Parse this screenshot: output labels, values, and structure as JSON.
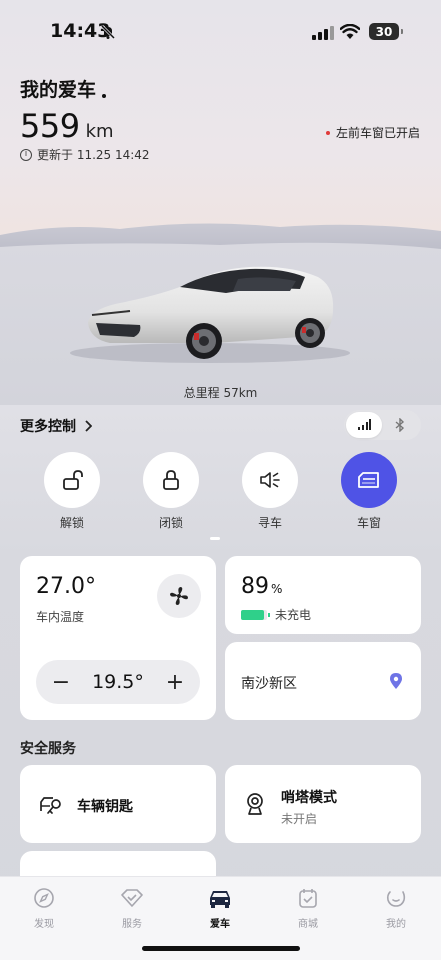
{
  "status_bar": {
    "time": "14:43",
    "battery": "30"
  },
  "header": {
    "title": "我的爱车",
    "range_value": "559",
    "range_unit": "km",
    "updated": "更新于 11.25 14:42",
    "alert": "左前车窗已开启"
  },
  "vehicle": {
    "odometer": "总里程 57km"
  },
  "controls": {
    "more_label": "更多控制",
    "connection_mode": "cellular",
    "buttons": [
      {
        "label": "解锁",
        "icon": "unlock-icon",
        "active": false
      },
      {
        "label": "闭锁",
        "icon": "lock-icon",
        "active": false
      },
      {
        "label": "寻车",
        "icon": "horn-icon",
        "active": false
      },
      {
        "label": "车窗",
        "icon": "window-icon",
        "active": true
      }
    ]
  },
  "climate": {
    "cabin_temp": "27.0°",
    "cabin_label": "车内温度",
    "set_temp": "19.5°",
    "minus": "−",
    "plus": "+"
  },
  "battery": {
    "percent": "89",
    "unit": "%",
    "status": "未充电",
    "level": 0.89
  },
  "location": {
    "name": "南沙新区"
  },
  "safety": {
    "title": "安全服务",
    "key_label": "车辆钥匙",
    "sentry_label": "哨塔模式",
    "sentry_status": "未开启"
  },
  "tabbar": {
    "tabs": [
      {
        "label": "发现",
        "icon": "compass-icon",
        "active": false
      },
      {
        "label": "服务",
        "icon": "service-icon",
        "active": false
      },
      {
        "label": "爱车",
        "icon": "car-icon",
        "active": true
      },
      {
        "label": "商城",
        "icon": "shop-icon",
        "active": false
      },
      {
        "label": "我的",
        "icon": "profile-icon",
        "active": false
      }
    ]
  },
  "colors": {
    "accent": "#4f53e6",
    "battery_green": "#2fd08a",
    "alert_red": "#e03a3a"
  }
}
